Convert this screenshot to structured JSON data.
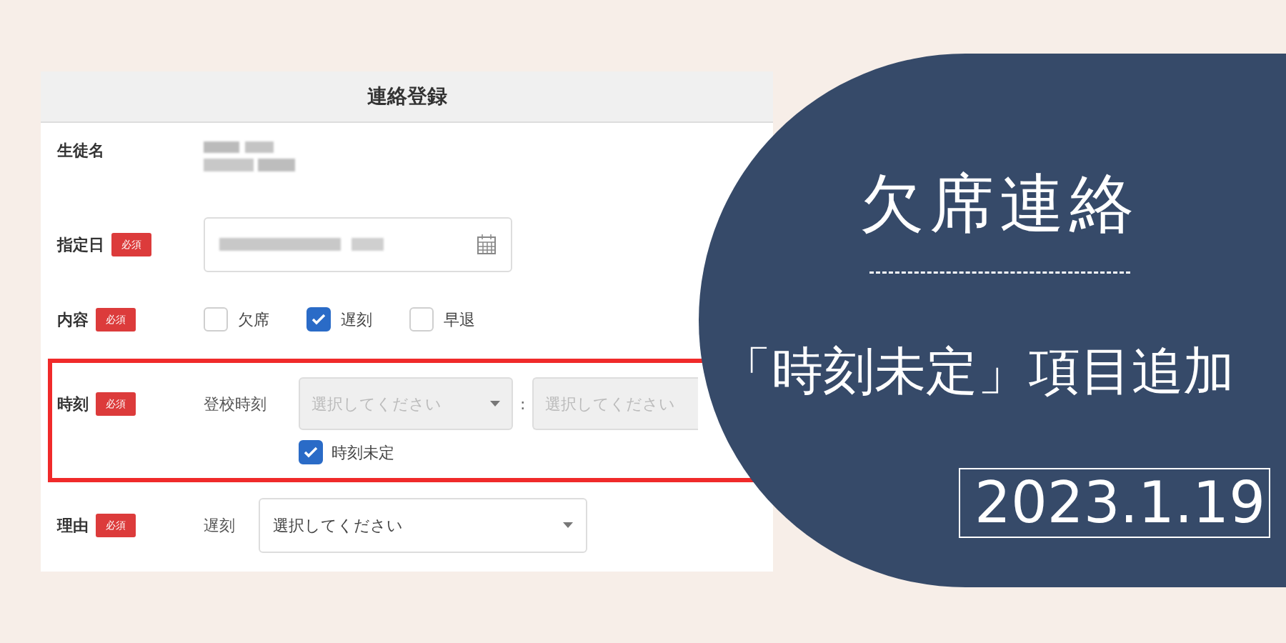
{
  "form": {
    "title": "連絡登録",
    "fields": [
      {
        "kind": "name",
        "label": "生徒名"
      },
      {
        "kind": "date",
        "label": "指定日",
        "badge": "必須"
      },
      {
        "kind": "checks",
        "label": "内容",
        "badge": "必須",
        "options": [
          {
            "label": "欠席",
            "checked": false
          },
          {
            "label": "遅刻",
            "checked": true
          },
          {
            "label": "早退",
            "checked": false
          }
        ]
      },
      {
        "kind": "time",
        "label": "時刻",
        "badge": "必須",
        "highlighted": true,
        "sublabel": "登校時刻",
        "selects": [
          {
            "placeholder": "選択してください"
          },
          {
            "placeholder": "選択してください"
          }
        ],
        "separator": ":",
        "undecided": {
          "label": "時刻未定",
          "checked": true
        }
      },
      {
        "kind": "select",
        "label": "理由",
        "badge": "必須",
        "sublabel": "遅刻",
        "select": {
          "placeholder": "選択してください"
        }
      }
    ]
  },
  "banner": {
    "title": "欠席連絡",
    "subtitle": "「時刻未定」項目追加",
    "date": "2023.1.19"
  }
}
